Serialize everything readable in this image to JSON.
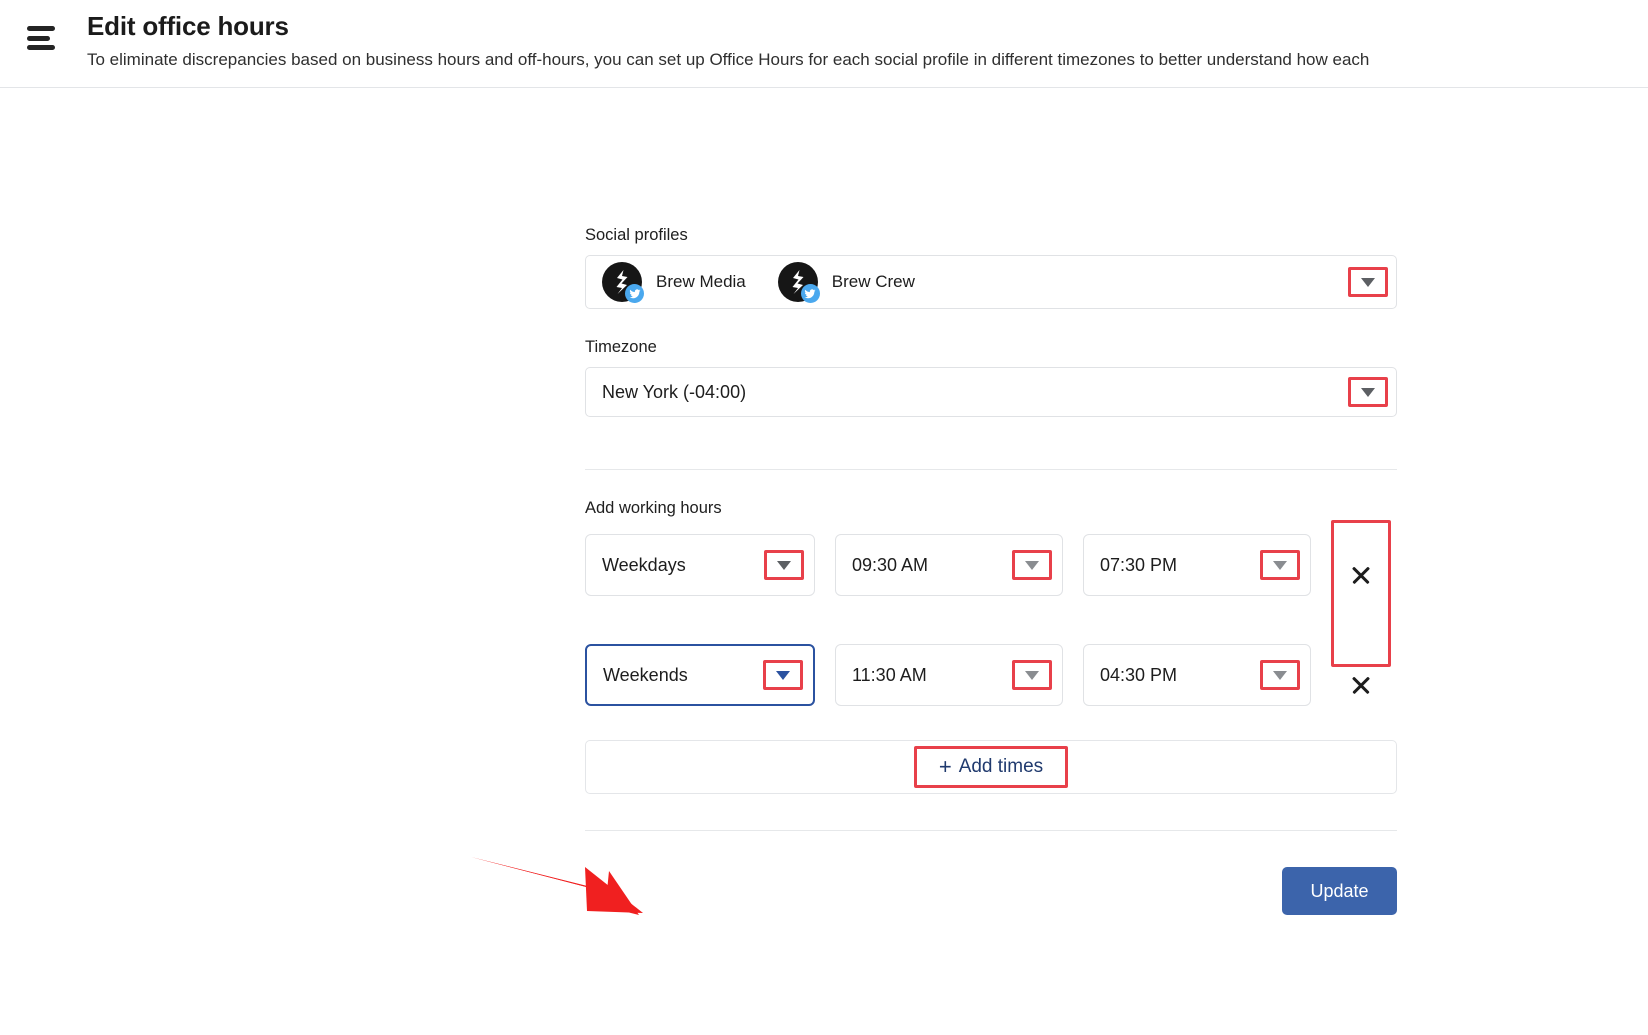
{
  "header": {
    "menu_icon": "hamburger-icon",
    "title": "Edit office hours",
    "subtitle": "To eliminate discrepancies based on business hours and off-hours, you can set up Office Hours for each social profile in different timezones to better understand how each"
  },
  "form": {
    "social_profiles": {
      "label": "Social profiles",
      "profiles": [
        {
          "name": "Brew Media",
          "network": "twitter",
          "avatar_icon": "brew-avatar-icon"
        },
        {
          "name": "Brew Crew",
          "network": "twitter",
          "avatar_icon": "brew-avatar-icon"
        }
      ],
      "dropdown_icon": "chevron-down-icon"
    },
    "timezone": {
      "label": "Timezone",
      "value": "New York (-04:00)",
      "dropdown_icon": "chevron-down-icon"
    },
    "working_hours": {
      "label": "Add working hours",
      "rows": [
        {
          "day": "Weekdays",
          "start_time": "09:30 AM",
          "end_time": "07:30 PM",
          "focused": false,
          "remove_icon": "close-icon"
        },
        {
          "day": "Weekends",
          "start_time": "11:30 AM",
          "end_time": "04:30 PM",
          "focused": true,
          "remove_icon": "close-icon"
        }
      ],
      "add_times": {
        "plus_icon": "plus-icon",
        "label": "Add times"
      }
    },
    "update_button": "Update"
  },
  "annotations": {
    "highlight_color": "#e8404a",
    "pointer_arrow_color": "#f02020",
    "focus_border_color": "#2b52a0",
    "primary_button_color": "#3c64ab"
  }
}
